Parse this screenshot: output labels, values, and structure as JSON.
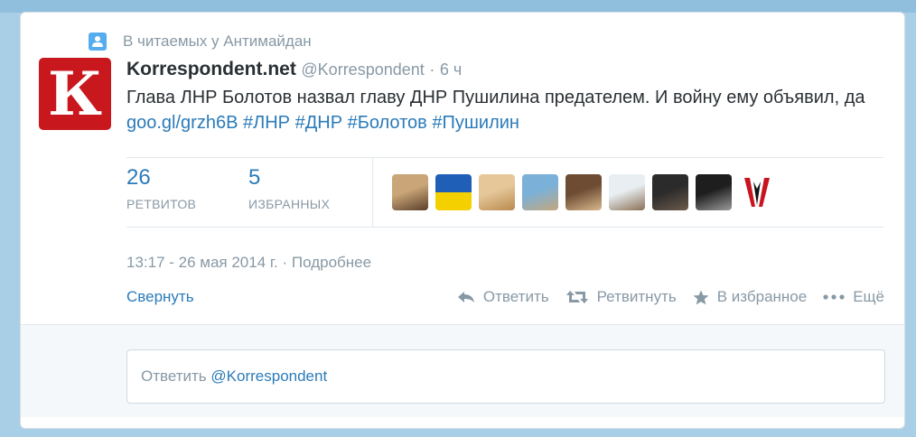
{
  "context": {
    "text": "В читаемых у Антимайдан",
    "icon": "user-icon"
  },
  "author": {
    "avatar_letter": "К",
    "avatar_color": "#c8181e",
    "name": "Korrespondent.net",
    "handle": "@Korrespondent",
    "separator": "·",
    "time": "6 ч"
  },
  "tweet": {
    "text": "Глава ЛНР Болотов назвал главу ДНР Пушилина предателем. И войну ему объявил, да",
    "link": "goo.gl/grzh6B",
    "hashtags": [
      "#ЛНР",
      "#ДНР",
      "#Болотов",
      "#Пушилин"
    ]
  },
  "stats": {
    "retweets": {
      "count": "26",
      "label": "РЕТВИТОВ"
    },
    "favorites": {
      "count": "5",
      "label": "ИЗБРАННЫХ"
    }
  },
  "favoriters": [
    {
      "icon": "user-avatar-icon",
      "colors": [
        "#c9a577",
        "#5a3f2a"
      ]
    },
    {
      "icon": "ukraine-flag-icon",
      "colors": [
        "#1f5fb8",
        "#f5d000"
      ]
    },
    {
      "icon": "doge-icon",
      "colors": [
        "#e6c79a",
        "#b98a4e"
      ]
    },
    {
      "icon": "landscape-icon",
      "colors": [
        "#7bb1d8",
        "#c3a77d"
      ]
    },
    {
      "icon": "user-avatar-icon",
      "colors": [
        "#6d4c33",
        "#d9b88d"
      ]
    },
    {
      "icon": "website-logo-icon",
      "colors": [
        "#e8eef2",
        "#8a7055"
      ]
    },
    {
      "icon": "dark-scene-icon",
      "colors": [
        "#2b2b2b",
        "#6b5a4a"
      ]
    },
    {
      "icon": "face-icon",
      "colors": [
        "#1e1e1e",
        "#9a9a9a"
      ]
    },
    {
      "icon": "red-black-emblem-icon",
      "colors": [
        "#c8141e",
        "#111111"
      ]
    }
  ],
  "datetime": {
    "text": "13:17 - 26 мая 2014 г.",
    "separator": "·",
    "details": "Подробнее"
  },
  "actions": {
    "collapse": "Свернуть",
    "reply": "Ответить",
    "retweet": "Ретвитнуть",
    "favorite": "В избранное",
    "more": "Ещё"
  },
  "reply_box": {
    "prefix": "Ответить",
    "mention": "@Korrespondent"
  },
  "colors": {
    "link": "#2b7bb9",
    "muted": "#8899a6",
    "text": "#292f33",
    "accent": "#55acee"
  }
}
